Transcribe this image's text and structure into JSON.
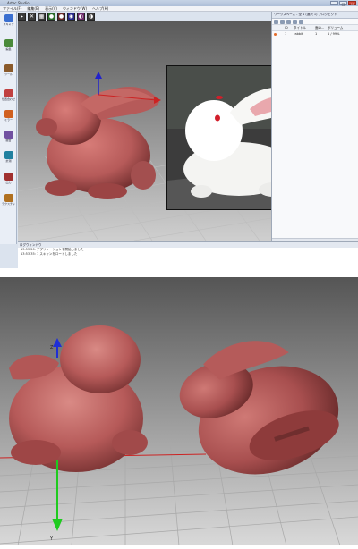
{
  "app": {
    "title": "Artec Studio",
    "window_controls": [
      "–",
      "□",
      "×"
    ]
  },
  "menu": [
    "ファイル(F)",
    "編集(E)",
    "表示(V)",
    "ウィンドウ(W)",
    "ヘルプ(H)"
  ],
  "left_tools": [
    {
      "label": "スキャン",
      "color": "#3a6fd0"
    },
    {
      "label": "編集",
      "color": "#4a8a3a"
    },
    {
      "label": "ツール",
      "color": "#8a5a2a"
    },
    {
      "label": "位置合わせ",
      "color": "#c04040"
    },
    {
      "label": "ミラー",
      "color": "#d06020"
    },
    {
      "label": "融合",
      "color": "#7050a0"
    },
    {
      "label": "計測",
      "color": "#2080a0"
    },
    {
      "label": "出力",
      "color": "#a03030"
    },
    {
      "label": "テクスチャ",
      "color": "#b07020"
    }
  ],
  "right_panel": {
    "title": "ワークスペース - 全 1 (選択 1) プロジェクト",
    "columns": [
      "ID",
      "タイトル",
      "面の...",
      "ボリューム"
    ],
    "rows": [
      {
        "id": "1",
        "name": "rabbit",
        "faces": "1",
        "volume": "1 / 99%"
      }
    ]
  },
  "log": {
    "title": "ログウィンドウ",
    "lines": [
      "13:53:20: アプリケーションを開始しました",
      "13:53:35: 1 スキャンをロードしました"
    ]
  },
  "axis_labels": {
    "z": "Z",
    "y": "Y"
  },
  "colors": {
    "model": "#b65a59",
    "model_dark": "#7d3434",
    "viewport_top": "#5a5a5a",
    "viewport_bottom": "#d3d3d3"
  }
}
